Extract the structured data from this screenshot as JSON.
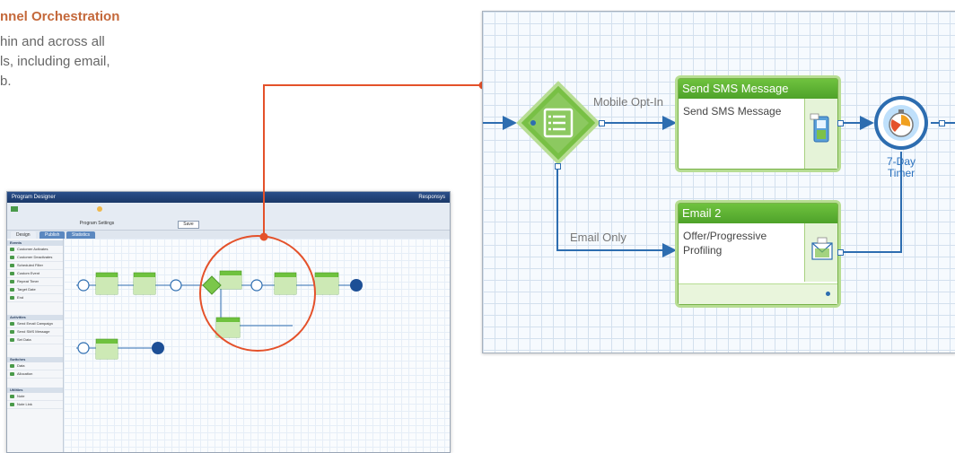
{
  "blurb": {
    "title": "nnel Orchestration",
    "lines": [
      "hin and across all",
      "ls, including email,",
      "b."
    ]
  },
  "mini_app": {
    "title": "Program Designer",
    "brand": "Responsys",
    "toolbar": {
      "settings_label": "Program Settings",
      "save_label": "Save"
    },
    "tabs": [
      "Design",
      "Publish",
      "Statistics"
    ],
    "sections": [
      {
        "title": "Events",
        "items": [
          "Customer Activates",
          "Customer Deactivates",
          "Scheduled Filter",
          "Custom Event",
          "Repeat Timer",
          "Target Date",
          "End"
        ]
      },
      {
        "title": "Activities",
        "items": [
          "Send Email Campaign",
          "Send SMS Message",
          "Set Data"
        ]
      },
      {
        "title": "Switches",
        "items": [
          "Data",
          "Allocation"
        ]
      },
      {
        "title": "Utilities",
        "items": [
          "Note",
          "Note Link"
        ]
      }
    ]
  },
  "zoom": {
    "edges": {
      "top": "Mobile Opt-In",
      "bottom": "Email Only"
    },
    "sms_node": {
      "header": "Send SMS Message",
      "body": "Send SMS Message"
    },
    "email_node": {
      "header": "Email 2",
      "body_line1": "Offer/Progressive",
      "body_line2": "Profiling"
    },
    "timer": {
      "line1": "7-Day",
      "line2": "Timer"
    }
  },
  "colors": {
    "accent_orange": "#e4512a",
    "node_green": "#5bb032",
    "connector_blue": "#2d6db0"
  }
}
